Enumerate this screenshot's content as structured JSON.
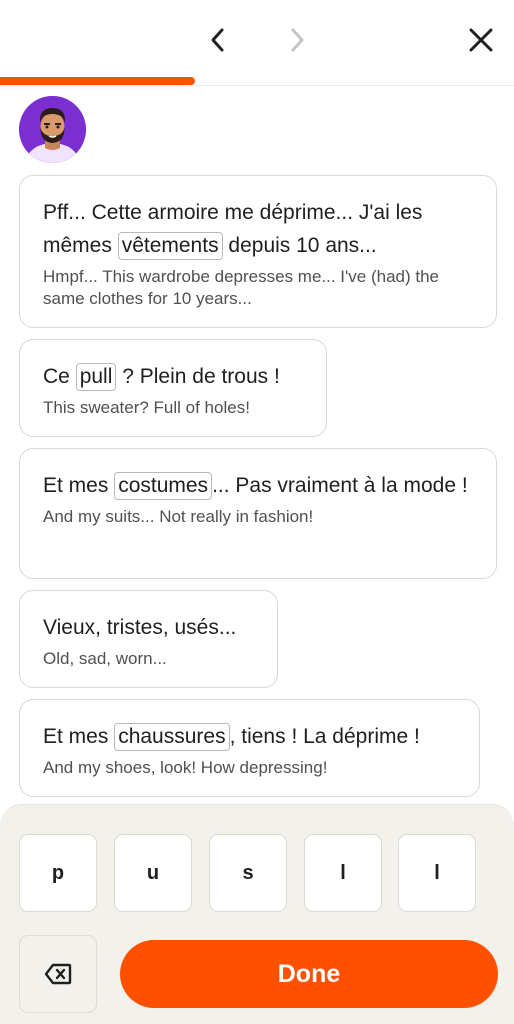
{
  "header": {
    "progress_fraction": 0.38,
    "accent_color": "#fe5100",
    "back_icon": "chevron-left-icon",
    "forward_icon": "chevron-right-icon",
    "close_icon": "close-icon"
  },
  "avatar": {
    "icon": "man-avatar-icon",
    "background": "#7b2fd0"
  },
  "messages": [
    {
      "fr_before": "Pff... Cette armoire me déprime... J'ai les mêmes ",
      "word": "vêtements",
      "fr_after": " depuis 10 ans...",
      "en": "Hmpf... This wardrobe depresses me... I've (had) the same clothes for 10 years..."
    },
    {
      "fr_before": "Ce ",
      "word": "pull",
      "fr_after": " ? Plein de trous !",
      "en": "This sweater? Full of holes!"
    },
    {
      "fr_before": "Et mes ",
      "word": "costumes",
      "fr_after": "... Pas vraiment à la mode !",
      "en": "And my suits... Not really in fashion!"
    },
    {
      "fr_before": "Vieux, tristes, usés...",
      "word": "",
      "fr_after": "",
      "en": "Old, sad, worn..."
    },
    {
      "fr_before": "Et mes ",
      "word": "chaussures",
      "fr_after": ", tiens ! La déprime !",
      "en": "And my shoes, look! How depressing!"
    }
  ],
  "keyboard": {
    "keys": [
      "p",
      "u",
      "s",
      "l",
      "l"
    ],
    "backspace_icon": "backspace-icon",
    "done_label": "Done"
  }
}
